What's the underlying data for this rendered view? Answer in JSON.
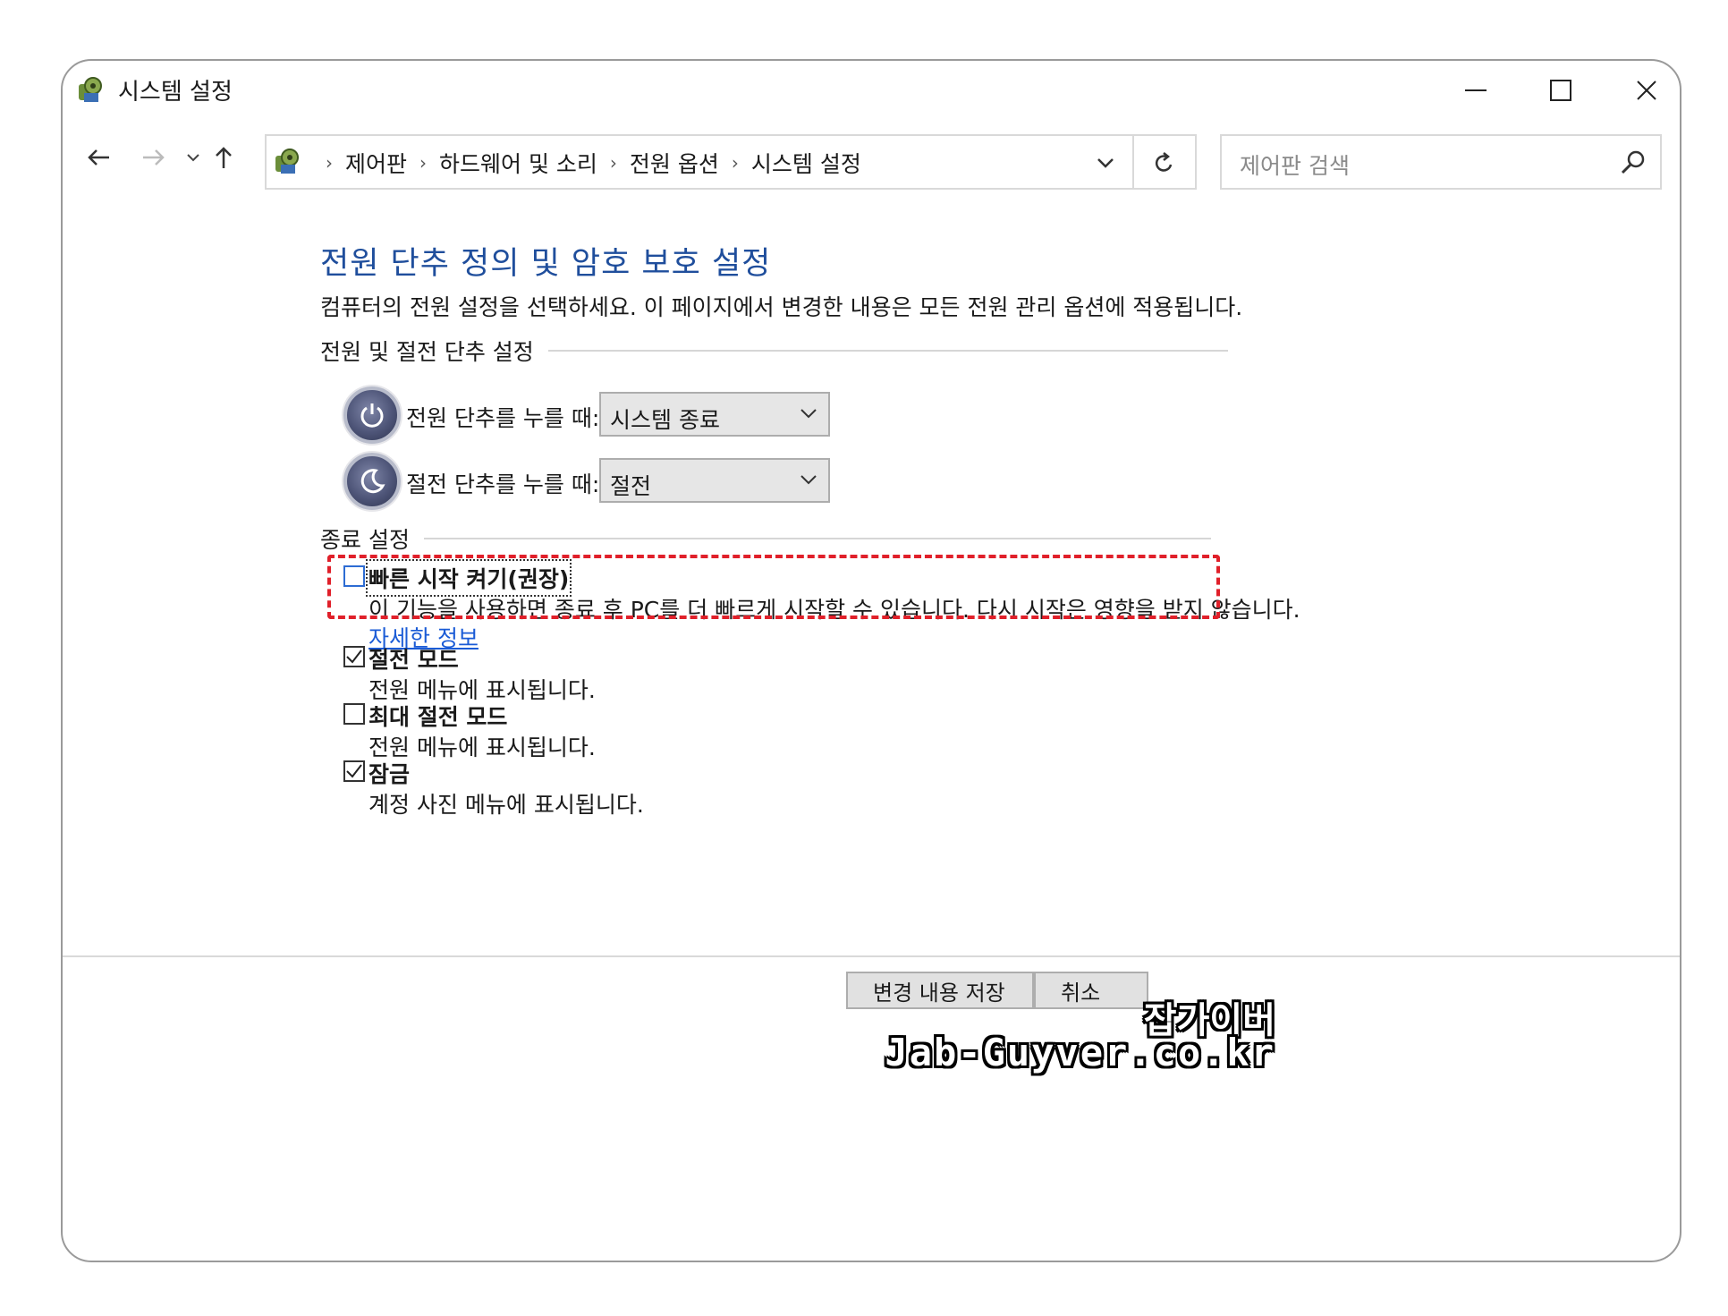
{
  "window": {
    "title": "시스템 설정"
  },
  "nav": {
    "breadcrumbs": [
      "제어판",
      "하드웨어 및 소리",
      "전원 옵션",
      "시스템 설정"
    ],
    "search_placeholder": "제어판 검색"
  },
  "main": {
    "title": "전원 단추 정의 및 암호 보호 설정",
    "description": "컴퓨터의 전원 설정을 선택하세요. 이 페이지에서 변경한 내용은 모든 전원 관리 옵션에 적용됩니다.",
    "power_section_label": "전원 및 절전 단추 설정",
    "power_button": {
      "label": "전원 단추를 누를 때:",
      "value": "시스템 종료"
    },
    "sleep_button": {
      "label": "절전 단추를 누를 때:",
      "value": "절전"
    },
    "shutdown_section_label": "종료 설정",
    "options": [
      {
        "label": "빠른 시작 켜기(권장)",
        "description": "이 기능을 사용하면 종료 후 PC를 더 빠르게 시작할 수 있습니다. 다시 시작은 영향을 받지 않습니다.",
        "link": "자세한 정보",
        "checked": false
      },
      {
        "label": "절전 모드",
        "description": "전원 메뉴에 표시됩니다.",
        "checked": true
      },
      {
        "label": "최대 절전 모드",
        "description": "전원 메뉴에 표시됩니다.",
        "checked": false
      },
      {
        "label": "잠금",
        "description": "계정 사진 메뉴에 표시됩니다.",
        "checked": true
      }
    ]
  },
  "footer": {
    "save_label": "변경 내용 저장",
    "cancel_label": "취소"
  },
  "watermark": {
    "korean": "잡가이버",
    "domain": "Jab-Guyver.co.kr"
  },
  "colors": {
    "title_blue": "#1f4e9c",
    "link_blue": "#1a5bd6",
    "highlight_red": "#e0202a"
  }
}
